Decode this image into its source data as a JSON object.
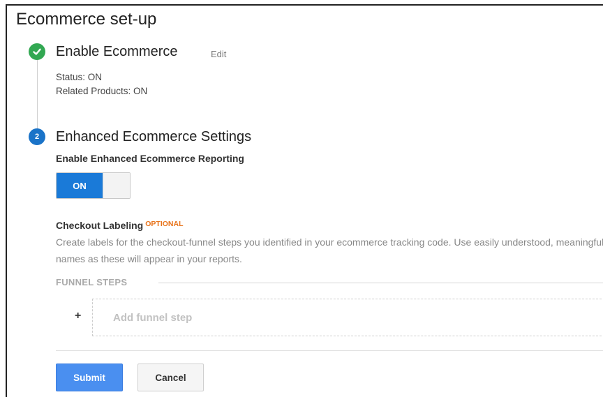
{
  "page": {
    "title": "Ecommerce set-up"
  },
  "step1": {
    "title": "Enable Ecommerce",
    "edit_label": "Edit",
    "status_lines": [
      "Status: ON",
      "Related Products: ON"
    ],
    "state": "complete"
  },
  "step2": {
    "number": "2",
    "title": "Enhanced Ecommerce Settings",
    "reporting_label": "Enable Enhanced Ecommerce Reporting",
    "toggle_label": "ON",
    "toggle_state": "on",
    "checkout_label": "Checkout Labeling",
    "optional_label": "OPTIONAL",
    "description": "Create labels for the checkout-funnel steps you identified in your ecommerce tracking code. Use easily understood, meaningful names as these will appear in your reports.",
    "funnel_header": "FUNNEL STEPS",
    "add_step_symbol": "+",
    "add_step_placeholder": "Add funnel step"
  },
  "actions": {
    "submit_label": "Submit",
    "cancel_label": "Cancel"
  },
  "colors": {
    "complete_green": "#32a852",
    "step_blue": "#1a73c8",
    "toggle_blue": "#1a7ad8",
    "optional_orange": "#e8731a",
    "submit_blue": "#4a8ff0"
  },
  "icons": {
    "step1_badge": "check-icon"
  }
}
